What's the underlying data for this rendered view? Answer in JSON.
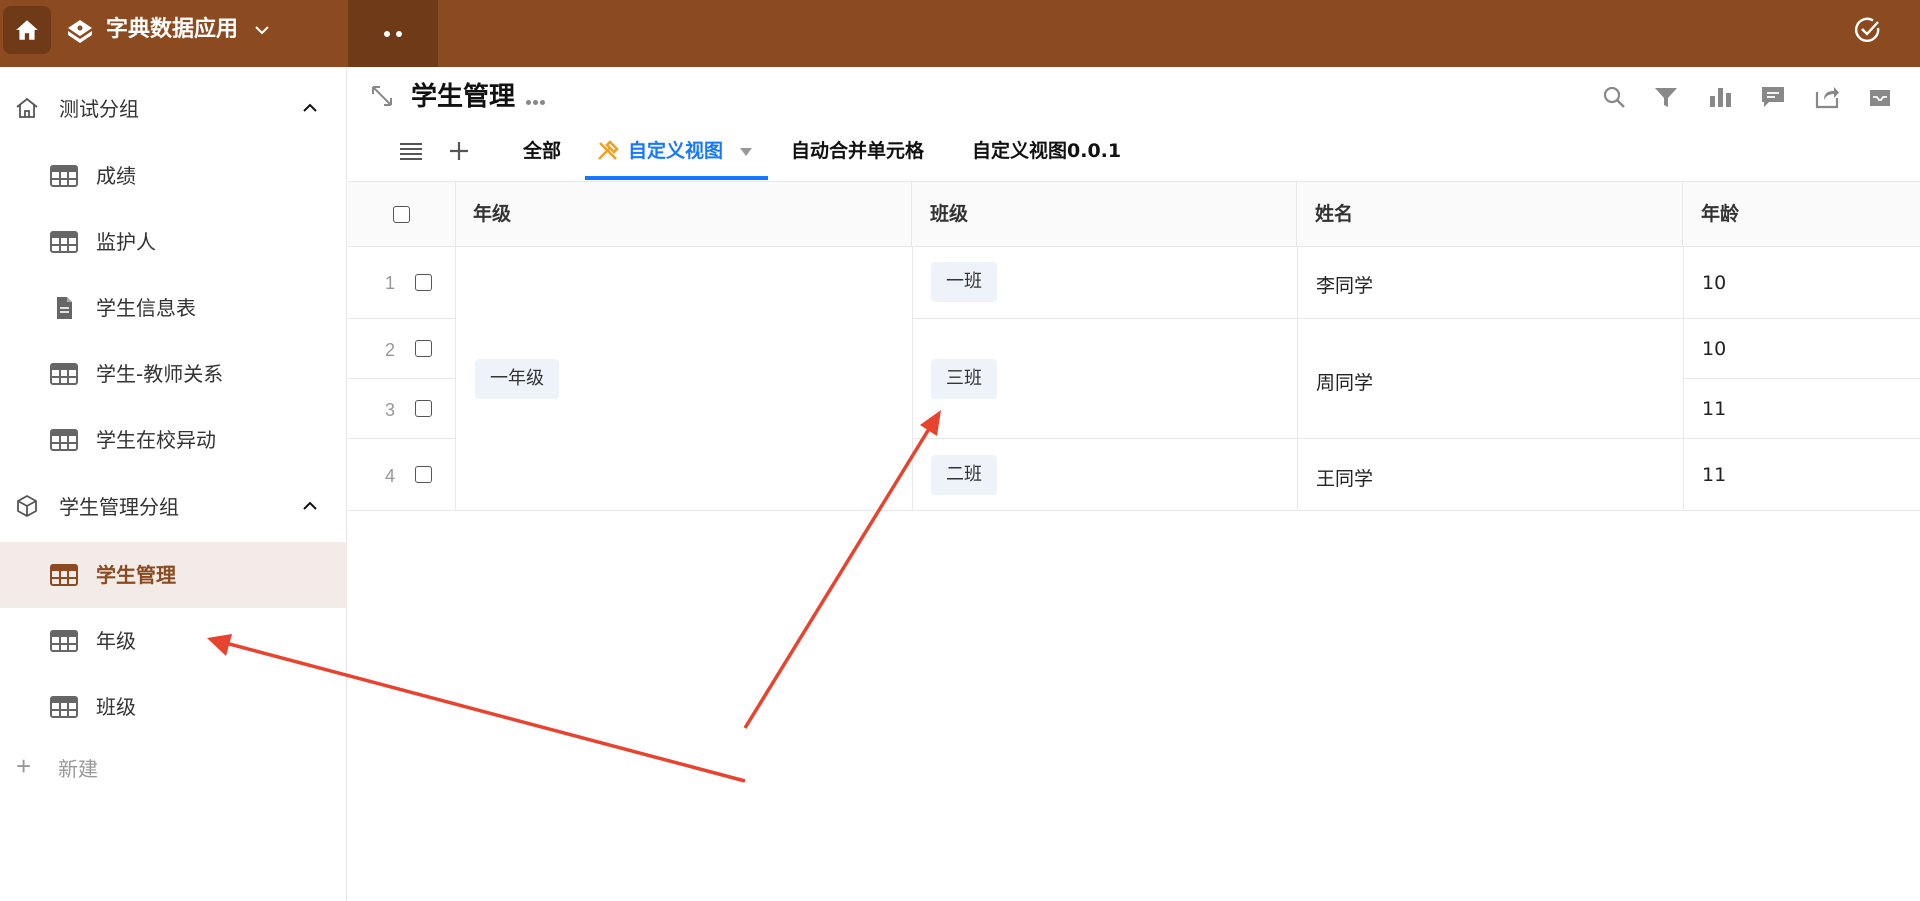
{
  "topbar": {
    "app_title": "字典数据应用",
    "home_icon": "home-icon",
    "app_icon": "cake-icon",
    "check_icon": "check-circle-icon",
    "background": "#8b4a1f"
  },
  "sidebar": {
    "groups": [
      {
        "label": "测试分组",
        "icon": "home-outline-icon",
        "items": [
          {
            "label": "成绩",
            "icon": "grid-table-icon"
          },
          {
            "label": "监护人",
            "icon": "grid-table-icon"
          },
          {
            "label": "学生信息表",
            "icon": "document-icon"
          },
          {
            "label": "学生-教师关系",
            "icon": "grid-table-icon"
          },
          {
            "label": "学生在校异动",
            "icon": "grid-table-icon"
          }
        ]
      },
      {
        "label": "学生管理分组",
        "icon": "cube-icon",
        "items": [
          {
            "label": "学生管理",
            "icon": "grid-table-icon",
            "active": true
          },
          {
            "label": "年级",
            "icon": "grid-table-icon"
          },
          {
            "label": "班级",
            "icon": "grid-table-icon"
          }
        ]
      }
    ],
    "new_label": "新建",
    "active_bg": "#f3ebe7"
  },
  "main": {
    "title": "学生管理",
    "toolbar_icons": [
      "search-icon",
      "filter-icon",
      "bar-chart-icon",
      "comment-icon",
      "share-icon",
      "inbox-icon"
    ],
    "tabs": [
      {
        "label": "全部"
      },
      {
        "label": "自定义视图",
        "active": true,
        "icon": "tools-icon"
      },
      {
        "label": "自动合并单元格"
      },
      {
        "label": "自定义视图0.0.1"
      }
    ],
    "accent": "#1677ff"
  },
  "table": {
    "columns": [
      "年级",
      "班级",
      "姓名",
      "年龄"
    ],
    "row_numbers": [
      "1",
      "2",
      "3",
      "4"
    ],
    "grade": "一年级",
    "classes": [
      "一班",
      "三班",
      "二班"
    ],
    "names": [
      "李同学",
      "周同学",
      "王同学"
    ],
    "ages": [
      "10",
      "10",
      "11",
      "11"
    ]
  },
  "annotation": {
    "arrow_color": "#e8432e"
  }
}
